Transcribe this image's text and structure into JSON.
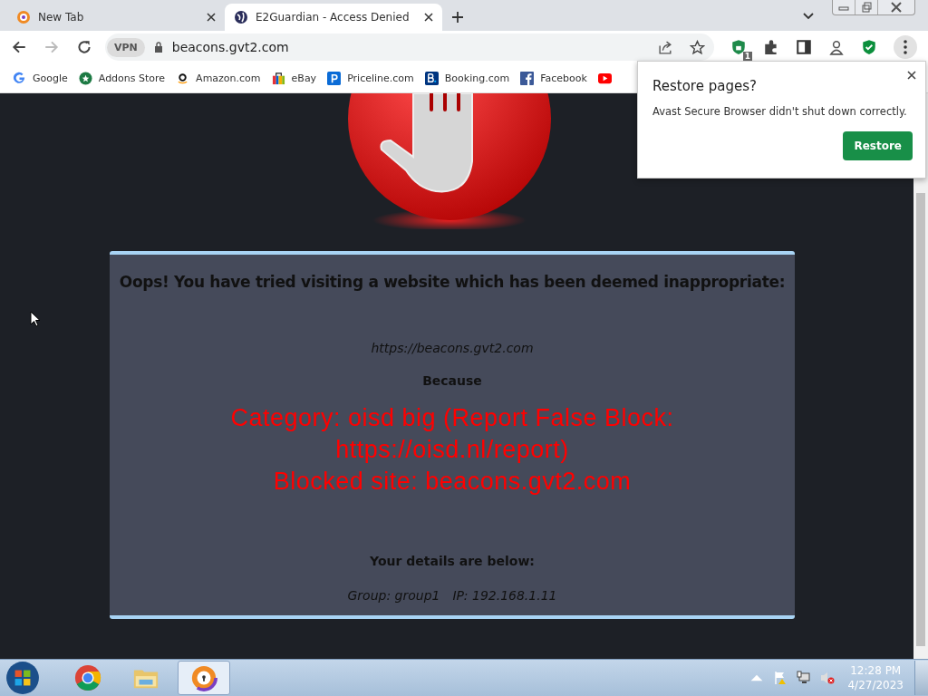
{
  "tabs": [
    {
      "title": "New Tab",
      "selected": false
    },
    {
      "title": "E2Guardian - Access Denied",
      "selected": true
    }
  ],
  "address_bar": {
    "vpn_label": "VPN",
    "url": "beacons.gvt2.com"
  },
  "extension_badge": "1",
  "bookmarks": [
    {
      "label": "Google"
    },
    {
      "label": "Addons Store"
    },
    {
      "label": "Amazon.com"
    },
    {
      "label": "eBay"
    },
    {
      "label": "Priceline.com"
    },
    {
      "label": "Booking.com"
    },
    {
      "label": "Facebook"
    }
  ],
  "restore_popup": {
    "title": "Restore pages?",
    "message": "Avast Secure Browser didn't shut down correctly.",
    "button": "Restore"
  },
  "page": {
    "heading": "Oops! You have tried visiting a website which has been deemed inappropriate:",
    "blocked_url": "https://beacons.gvt2.com",
    "because_label": "Because",
    "category_line": "Category: oisd big (Report False Block: https://oisd.nl/report)",
    "blocked_site_line": "Blocked site: beacons.gvt2.com",
    "details_label": "Your details are below:",
    "group": "Group: group1",
    "ip": "IP: 192.168.1.11"
  },
  "taskbar": {
    "apps": [
      {
        "selected": false
      },
      {
        "selected": false
      },
      {
        "selected": true
      }
    ],
    "time": "12:28 PM",
    "date": "4/27/2023"
  }
}
